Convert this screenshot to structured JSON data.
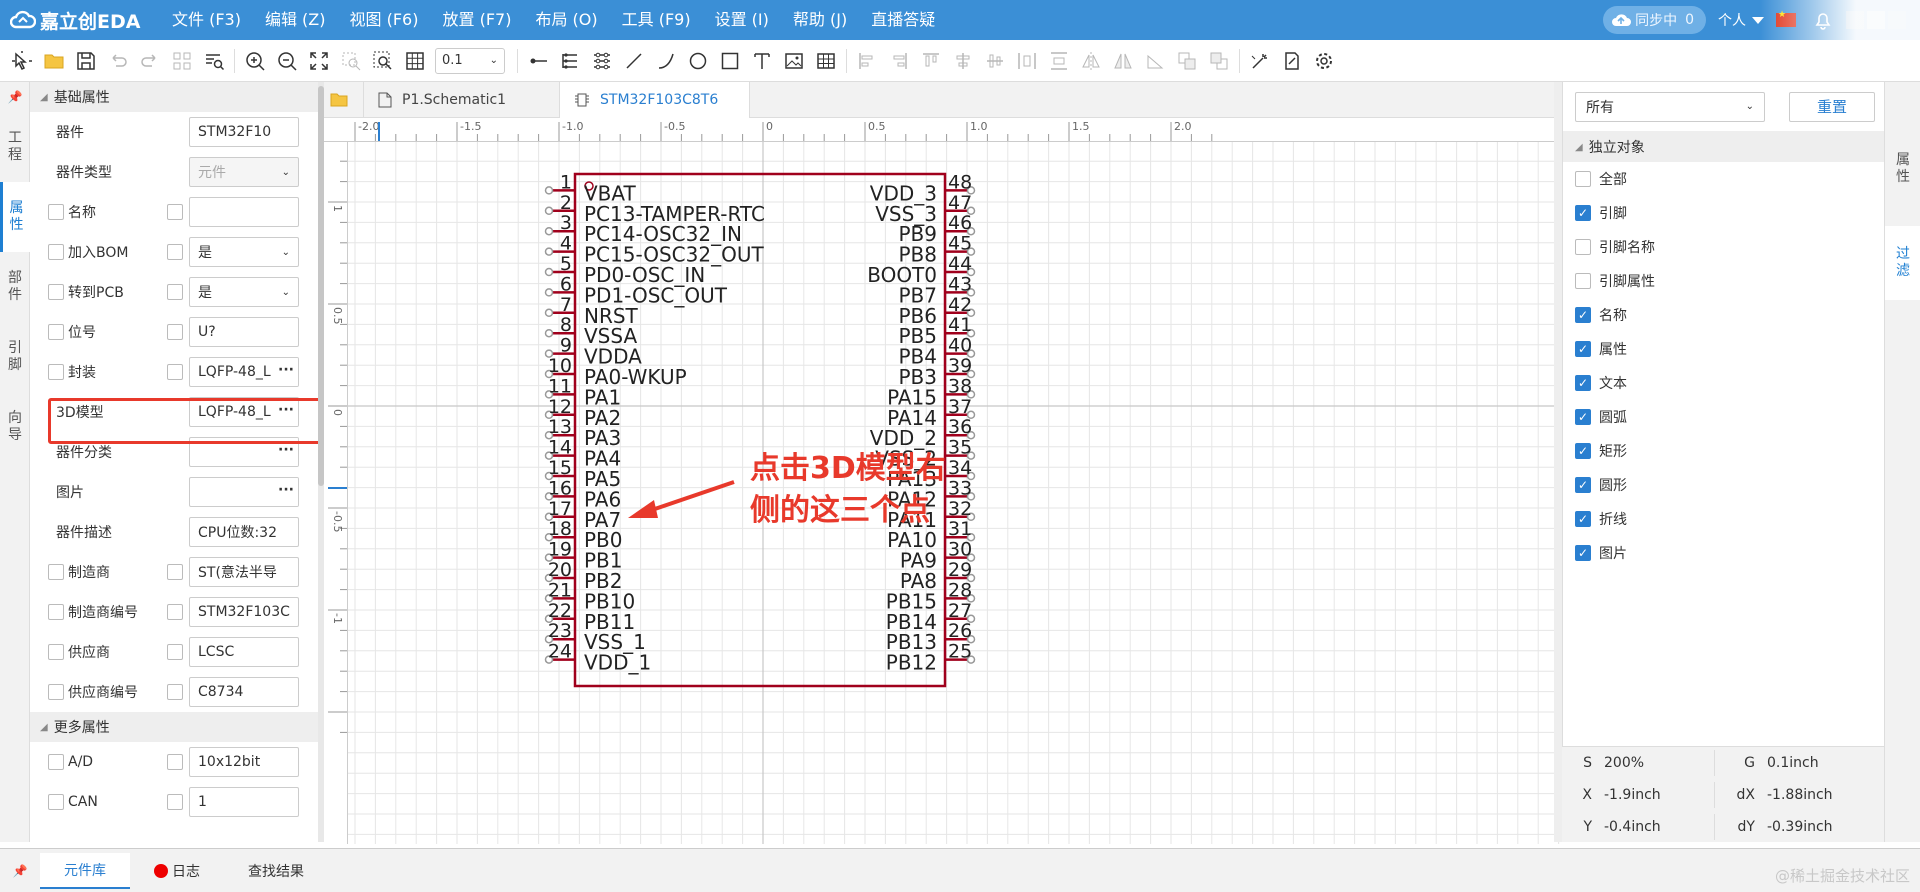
{
  "app": {
    "logo_text": "嘉立创EDA"
  },
  "menu": [
    "文件 (F3)",
    "编辑 (Z)",
    "视图 (F6)",
    "放置 (F7)",
    "布局 (O)",
    "工具 (F9)",
    "设置 (I)",
    "帮助 (J)",
    "直播答疑"
  ],
  "titlebar": {
    "sync_label": "同步中",
    "sync_count": "0",
    "user": "个人"
  },
  "toolbar": {
    "grid_value": "0.1"
  },
  "left_tabs": [
    "工程",
    "属性",
    "部件",
    "引脚",
    "向导"
  ],
  "props": {
    "section_basic": "基础属性",
    "section_more": "更多属性",
    "rows": [
      {
        "label": "器件",
        "value": "STM32F10",
        "kind": "text",
        "cb": false
      },
      {
        "label": "器件类型",
        "value": "元件",
        "kind": "select-disabled",
        "cb": false
      },
      {
        "label": "名称",
        "value": "",
        "kind": "text",
        "cb": true
      },
      {
        "label": "加入BOM",
        "value": "是",
        "kind": "select",
        "cb": true
      },
      {
        "label": "转到PCB",
        "value": "是",
        "kind": "select",
        "cb": true
      },
      {
        "label": "位号",
        "value": "U?",
        "kind": "text",
        "cb": true
      },
      {
        "label": "封装",
        "value": "LQFP-48_L",
        "kind": "dots",
        "cb": true
      },
      {
        "label": "3D模型",
        "value": "LQFP-48_L",
        "kind": "dots",
        "cb": false
      },
      {
        "label": "器件分类",
        "value": "",
        "kind": "dots",
        "cb": false
      },
      {
        "label": "图片",
        "value": "",
        "kind": "dots",
        "cb": false
      },
      {
        "label": "器件描述",
        "value": "CPU位数:32",
        "kind": "text",
        "cb": false
      },
      {
        "label": "制造商",
        "value": "ST(意法半导",
        "kind": "text",
        "cb": true
      },
      {
        "label": "制造商编号",
        "value": "STM32F103C",
        "kind": "text",
        "cb": true
      },
      {
        "label": "供应商",
        "value": "LCSC",
        "kind": "text",
        "cb": true
      },
      {
        "label": "供应商编号",
        "value": "C8734",
        "kind": "text",
        "cb": true
      }
    ],
    "more_rows": [
      {
        "label": "A/D",
        "value": "10x12bit",
        "cb": true
      },
      {
        "label": "CAN",
        "value": "1",
        "cb": true
      }
    ]
  },
  "doc_tabs": [
    "P1.Schematic1",
    "STM32F103C8T6"
  ],
  "ruler": {
    "top_labels": [
      "-2.0",
      "-1.5",
      "-1.0",
      "-0.5",
      "0",
      "0.5",
      "1.0",
      "1.5",
      "2.0"
    ],
    "left_labels": [
      "1",
      "0.5",
      "0",
      "-0.5",
      "-1"
    ]
  },
  "annotation": {
    "line1": "点击3D模型右",
    "line2": "侧的这三个点"
  },
  "symbol": {
    "left_pins": [
      {
        "num": "1",
        "name": "VBAT"
      },
      {
        "num": "2",
        "name": "PC13-TAMPER-RTC"
      },
      {
        "num": "3",
        "name": "PC14-OSC32_IN"
      },
      {
        "num": "4",
        "name": "PC15-OSC32_OUT"
      },
      {
        "num": "5",
        "name": "PD0-OSC_IN"
      },
      {
        "num": "6",
        "name": "PD1-OSC_OUT"
      },
      {
        "num": "7",
        "name": "NRST"
      },
      {
        "num": "8",
        "name": "VSSA"
      },
      {
        "num": "9",
        "name": "VDDA"
      },
      {
        "num": "10",
        "name": "PA0-WKUP"
      },
      {
        "num": "11",
        "name": "PA1"
      },
      {
        "num": "12",
        "name": "PA2"
      },
      {
        "num": "13",
        "name": "PA3"
      },
      {
        "num": "14",
        "name": "PA4"
      },
      {
        "num": "15",
        "name": "PA5"
      },
      {
        "num": "16",
        "name": "PA6"
      },
      {
        "num": "17",
        "name": "PA7"
      },
      {
        "num": "18",
        "name": "PB0"
      },
      {
        "num": "19",
        "name": "PB1"
      },
      {
        "num": "20",
        "name": "PB2"
      },
      {
        "num": "21",
        "name": "PB10"
      },
      {
        "num": "22",
        "name": "PB11"
      },
      {
        "num": "23",
        "name": "VSS_1"
      },
      {
        "num": "24",
        "name": "VDD_1"
      }
    ],
    "right_pins": [
      {
        "num": "48",
        "name": "VDD_3"
      },
      {
        "num": "47",
        "name": "VSS_3"
      },
      {
        "num": "46",
        "name": "PB9"
      },
      {
        "num": "45",
        "name": "PB8"
      },
      {
        "num": "44",
        "name": "BOOT0"
      },
      {
        "num": "43",
        "name": "PB7"
      },
      {
        "num": "42",
        "name": "PB6"
      },
      {
        "num": "41",
        "name": "PB5"
      },
      {
        "num": "40",
        "name": "PB4"
      },
      {
        "num": "39",
        "name": "PB3"
      },
      {
        "num": "38",
        "name": "PA15"
      },
      {
        "num": "37",
        "name": "PA14"
      },
      {
        "num": "36",
        "name": "VDD_2"
      },
      {
        "num": "35",
        "name": "VSS_2"
      },
      {
        "num": "34",
        "name": "PA13"
      },
      {
        "num": "33",
        "name": "PA12"
      },
      {
        "num": "32",
        "name": "PA11"
      },
      {
        "num": "31",
        "name": "PA10"
      },
      {
        "num": "30",
        "name": "PA9"
      },
      {
        "num": "29",
        "name": "PA8"
      },
      {
        "num": "28",
        "name": "PB15"
      },
      {
        "num": "27",
        "name": "PB14"
      },
      {
        "num": "26",
        "name": "PB13"
      },
      {
        "num": "25",
        "name": "PB12"
      }
    ]
  },
  "filter": {
    "select_value": "所有",
    "reset_label": "重置",
    "section": "独立对象",
    "items": [
      {
        "label": "全部",
        "checked": false
      },
      {
        "label": "引脚",
        "checked": true
      },
      {
        "label": "引脚名称",
        "checked": false
      },
      {
        "label": "引脚属性",
        "checked": false
      },
      {
        "label": "名称",
        "checked": true
      },
      {
        "label": "属性",
        "checked": true
      },
      {
        "label": "文本",
        "checked": true
      },
      {
        "label": "圆弧",
        "checked": true
      },
      {
        "label": "矩形",
        "checked": true
      },
      {
        "label": "圆形",
        "checked": true
      },
      {
        "label": "折线",
        "checked": true
      },
      {
        "label": "图片",
        "checked": true
      }
    ]
  },
  "coords": {
    "s_label": "S",
    "s_value": "200%",
    "g_label": "G",
    "g_value": "0.1inch",
    "x_label": "X",
    "x_value": "-1.9inch",
    "dx_label": "dX",
    "dx_value": "-1.88inch",
    "y_label": "Y",
    "y_value": "-0.4inch",
    "dy_label": "dY",
    "dy_value": "-0.39inch"
  },
  "right_tabs": [
    "属性",
    "过滤"
  ],
  "bottom_tabs": [
    "元件库",
    "日志",
    "查找结果"
  ],
  "watermark": "@稀土掘金技术社区",
  "colors": {
    "brand": "#3b8fd6",
    "accent": "#2a7fd0",
    "symbol": "#a0001c",
    "highlight": "#e8392b"
  }
}
